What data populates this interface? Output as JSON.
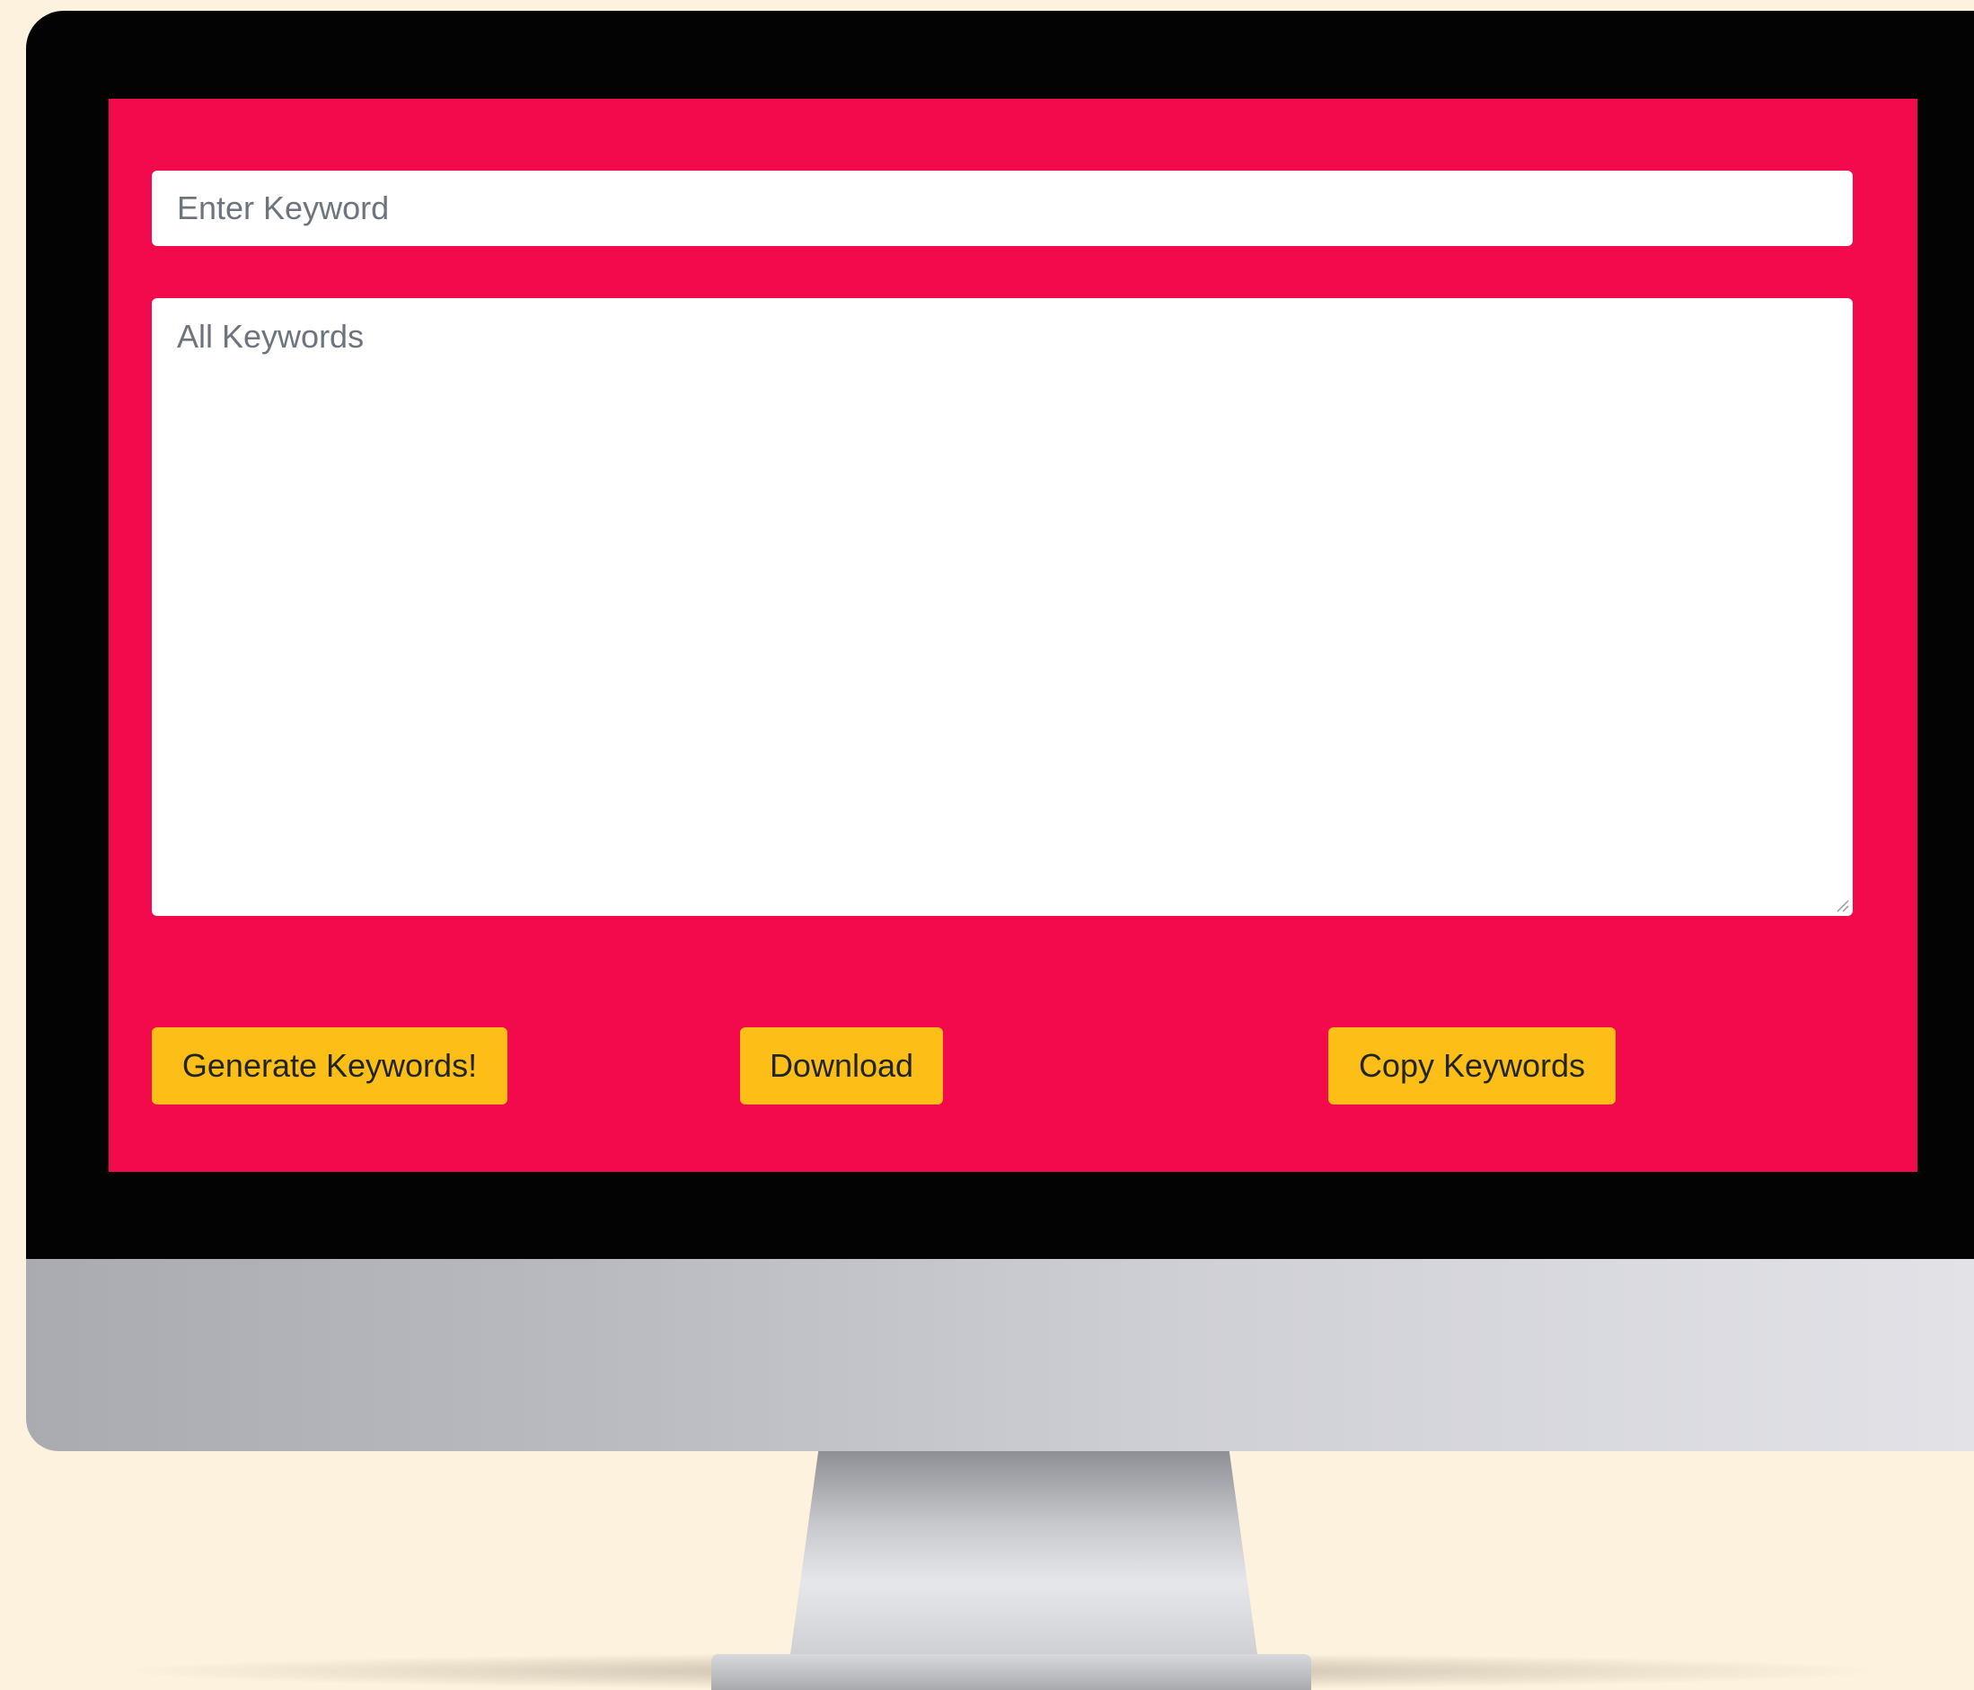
{
  "form": {
    "keyword_input": {
      "placeholder": "Enter Keyword",
      "value": ""
    },
    "keywords_textarea": {
      "placeholder": "All Keywords",
      "value": ""
    }
  },
  "actions": {
    "generate_label": "Generate Keywords!",
    "download_label": "Download",
    "copy_label": "Copy Keywords"
  },
  "colors": {
    "page_background": "#fdf2dd",
    "screen_background": "#f20a4d",
    "button_background": "#fdbf17",
    "bezel": "#030303"
  },
  "icons": {
    "resize_handle": "resize-grip-icon"
  }
}
